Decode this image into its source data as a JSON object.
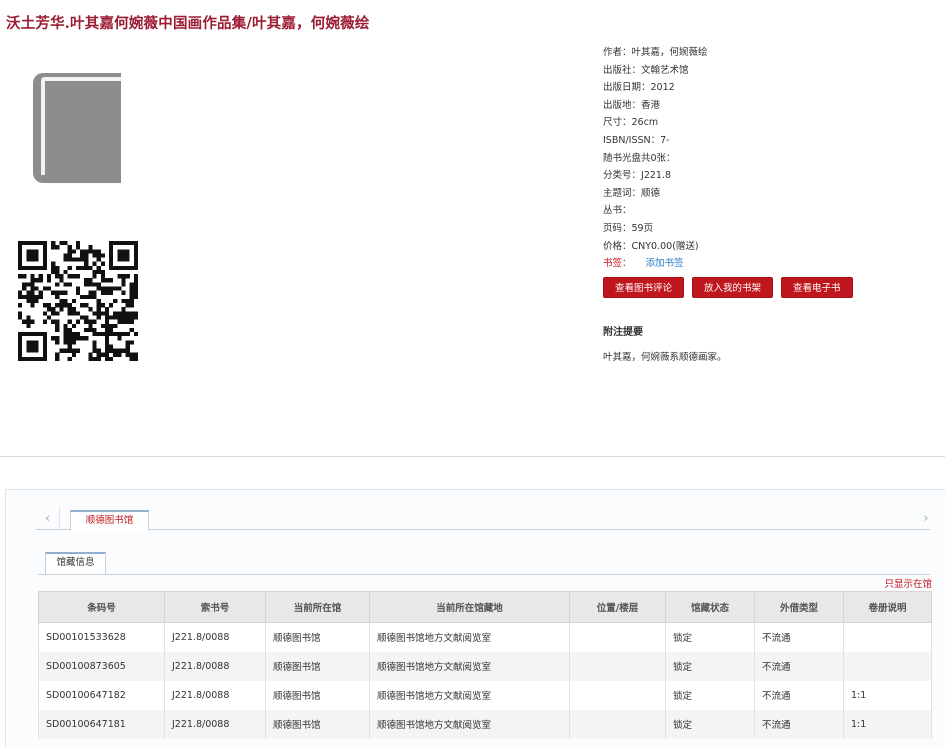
{
  "title": "沃土芳华.叶其嘉何婉薇中国画作品集/叶其嘉，何婉薇绘",
  "meta": [
    {
      "label": "作者：",
      "value": "叶其嘉，何婉薇绘"
    },
    {
      "label": "出版社：",
      "value": "文翰艺术馆"
    },
    {
      "label": "出版日期：",
      "value": "2012"
    },
    {
      "label": "出版地：",
      "value": "香港"
    },
    {
      "label": "尺寸：",
      "value": "26cm"
    },
    {
      "label": "ISBN/ISSN：",
      "value": "7-"
    },
    {
      "label": "随书光盘共0张：",
      "value": ""
    },
    {
      "label": "分类号：",
      "value": "J221.8"
    },
    {
      "label": "主题词：",
      "value": "顺德"
    },
    {
      "label": "丛书：",
      "value": ""
    },
    {
      "label": "页码：",
      "value": "59页"
    },
    {
      "label": "价格：",
      "value": "CNY0.00(赠送)"
    }
  ],
  "bookmark": {
    "label": "书签：",
    "link": "添加书签"
  },
  "buttons": {
    "reviews": "查看图书评论",
    "shelf": "放入我的书架",
    "ebook": "查看电子书"
  },
  "notes": {
    "heading": "附注提要",
    "text": "叶其嘉，何婉薇系顺德画家。"
  },
  "tabs": {
    "prev": "‹",
    "next": "›",
    "library": "顺德图书馆",
    "holdings": "馆藏信息"
  },
  "only_link": "只显示在馆",
  "table": {
    "headers": [
      "条码号",
      "索书号",
      "当前所在馆",
      "当前所在馆藏地",
      "位置/楼层",
      "馆藏状态",
      "外借类型",
      "卷册说明"
    ],
    "rows": [
      [
        "SD00101533628",
        "J221.8/0088",
        "顺德图书馆",
        "顺德图书馆地方文献阅览室",
        "",
        "锁定",
        "不流通",
        ""
      ],
      [
        "SD00100873605",
        "J221.8/0088",
        "顺德图书馆",
        "顺德图书馆地方文献阅览室",
        "",
        "锁定",
        "不流通",
        ""
      ],
      [
        "SD00100647182",
        "J221.8/0088",
        "顺德图书馆",
        "顺德图书馆地方文献阅览室",
        "",
        "锁定",
        "不流通",
        "1:1"
      ],
      [
        "SD00100647181",
        "J221.8/0088",
        "顺德图书馆",
        "顺德图书馆地方文献阅览室",
        "",
        "锁定",
        "不流通",
        "1:1"
      ]
    ]
  },
  "colors": {
    "accent": "#c0171f",
    "title": "#9b1c33",
    "link": "#2a7bc1"
  }
}
